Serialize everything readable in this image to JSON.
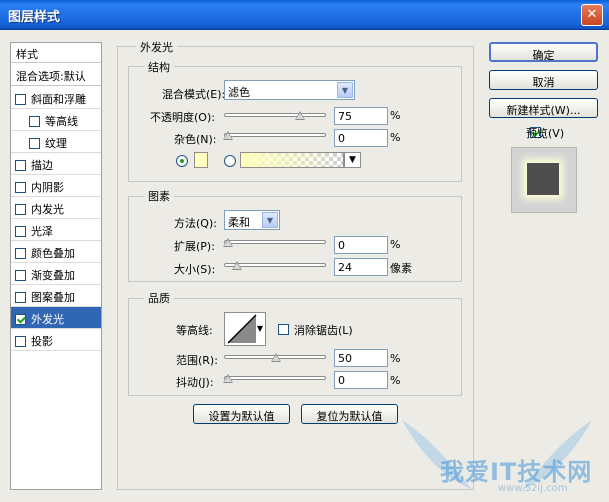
{
  "window": {
    "title": "图层样式",
    "close_glyph": "✕"
  },
  "style_list": {
    "header": "样式",
    "blend_options": "混合选项:默认",
    "items": [
      {
        "label": "斜面和浮雕",
        "checked": false
      },
      {
        "label": "等高线",
        "checked": false
      },
      {
        "label": "纹理",
        "checked": false
      },
      {
        "label": "描边",
        "checked": false
      },
      {
        "label": "内阴影",
        "checked": false
      },
      {
        "label": "内发光",
        "checked": false
      },
      {
        "label": "光泽",
        "checked": false
      },
      {
        "label": "颜色叠加",
        "checked": false
      },
      {
        "label": "渐变叠加",
        "checked": false
      },
      {
        "label": "图案叠加",
        "checked": false
      },
      {
        "label": "外发光",
        "checked": true,
        "selected": true
      },
      {
        "label": "投影",
        "checked": false
      }
    ]
  },
  "outer_glow": {
    "title": "外发光",
    "structure": {
      "title": "结构",
      "blend_mode_label": "混合模式(E):",
      "blend_mode_value": "滤色",
      "opacity_label": "不透明度(O):",
      "opacity_value": "75",
      "opacity_unit": "%",
      "opacity_level": 0.75,
      "noise_label": "杂色(N):",
      "noise_value": "0",
      "noise_unit": "%",
      "noise_level": 0.0,
      "glow_color": "#ffffbe",
      "color_radio_selected": true
    },
    "elements": {
      "title": "图素",
      "technique_label": "方法(Q):",
      "technique_value": "柔和",
      "spread_label": "扩展(P):",
      "spread_value": "0",
      "spread_unit": "%",
      "spread_level": 0.0,
      "size_label": "大小(S):",
      "size_value": "24",
      "size_unit": "像素",
      "size_level": 0.096
    },
    "quality": {
      "title": "品质",
      "contour_label": "等高线:",
      "anti_alias_label": "消除锯齿(L)",
      "anti_alias_checked": false,
      "range_label": "范围(R):",
      "range_value": "50",
      "range_unit": "%",
      "range_level": 0.5,
      "jitter_label": "抖动(J):",
      "jitter_value": "0",
      "jitter_unit": "%",
      "jitter_level": 0.0
    },
    "make_default_label": "设置为默认值",
    "reset_default_label": "复位为默认值"
  },
  "actions": {
    "ok_label": "确定",
    "cancel_label": "取消",
    "new_style_label": "新建样式(W)...",
    "preview_label": "预览(V)",
    "preview_checked": true
  },
  "watermark": {
    "text": "我爱IT技术网",
    "url": "www.52ij.com"
  },
  "icons": {
    "close": "close-icon",
    "dropdown": "chevron-down-icon",
    "checkbox_checked": "check-icon",
    "contour": "contour-curve-icon"
  },
  "colors": {
    "title_bar": "#1f6fe6",
    "selection": "#3166b4",
    "dialog_bg": "#ecebe6",
    "check_green": "#21a121"
  }
}
